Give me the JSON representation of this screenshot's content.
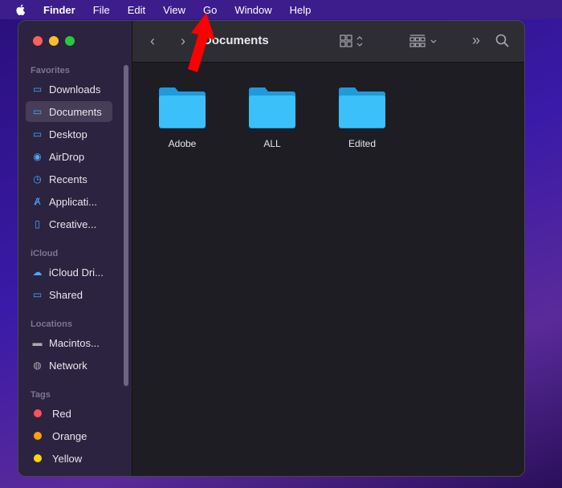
{
  "menubar": {
    "items": [
      "Finder",
      "File",
      "Edit",
      "View",
      "Go",
      "Window",
      "Help"
    ]
  },
  "window": {
    "title": "Documents"
  },
  "sidebar": {
    "sections": [
      {
        "label": "Favorites",
        "items": [
          {
            "label": "Downloads",
            "icon": "folder-icon"
          },
          {
            "label": "Documents",
            "icon": "folder-icon",
            "selected": true
          },
          {
            "label": "Desktop",
            "icon": "folder-icon"
          },
          {
            "label": "AirDrop",
            "icon": "airdrop-icon"
          },
          {
            "label": "Recents",
            "icon": "clock-icon"
          },
          {
            "label": "Applicati...",
            "icon": "applications-icon"
          },
          {
            "label": "Creative...",
            "icon": "document-icon"
          }
        ]
      },
      {
        "label": "iCloud",
        "items": [
          {
            "label": "iCloud Dri...",
            "icon": "cloud-icon"
          },
          {
            "label": "Shared",
            "icon": "shared-folder-icon"
          }
        ]
      },
      {
        "label": "Locations",
        "items": [
          {
            "label": "Macintos...",
            "icon": "disk-icon"
          },
          {
            "label": "Network",
            "icon": "globe-icon"
          }
        ]
      },
      {
        "label": "Tags",
        "items": [
          {
            "label": "Red",
            "color": "#ff5257"
          },
          {
            "label": "Orange",
            "color": "#ff9f0a"
          },
          {
            "label": "Yellow",
            "color": "#ffd60a"
          }
        ]
      }
    ]
  },
  "folders": [
    "Adobe",
    "ALL",
    "Edited"
  ],
  "colors": {
    "accent": "#4aa8ff",
    "folder": "#2fb0f0",
    "annotation": "#ff0000"
  }
}
